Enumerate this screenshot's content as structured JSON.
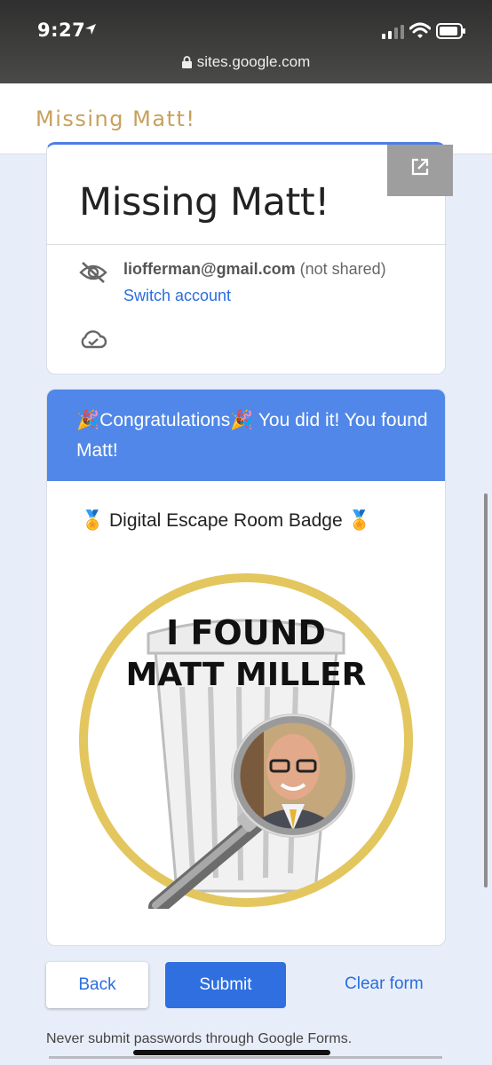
{
  "status": {
    "time": "9:27",
    "url": "sites.google.com"
  },
  "site": {
    "title": "Missing Matt!"
  },
  "form": {
    "title": "Missing Matt!",
    "account_email": "liofferman@gmail.com",
    "not_shared": "(not shared)",
    "switch_account": "Switch account"
  },
  "section": {
    "banner_text": "🎉Congratulations🎉 You did it! You found Matt!",
    "badge_line": "🏅 Digital Escape Room Badge 🏅",
    "badge_heading_line1": "I FOUND",
    "badge_heading_line2": "MATT MILLER"
  },
  "buttons": {
    "back": "Back",
    "submit": "Submit",
    "clear": "Clear form"
  },
  "footer": {
    "note": "Never submit passwords through Google Forms."
  },
  "colors": {
    "accent": "#4c7fe3",
    "site_title": "#c7a15b",
    "banner": "#5087e8",
    "badge_ring": "#e3c65e"
  }
}
